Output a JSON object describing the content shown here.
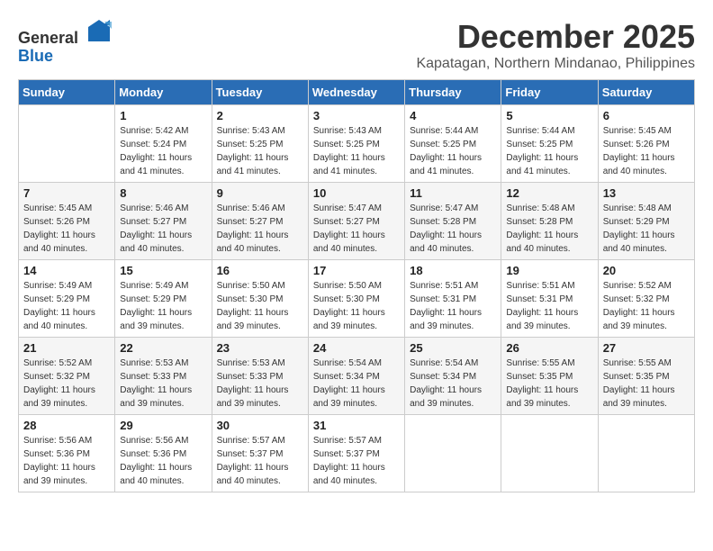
{
  "header": {
    "month_year": "December 2025",
    "location": "Kapatagan, Northern Mindanao, Philippines",
    "logo_general": "General",
    "logo_blue": "Blue"
  },
  "weekdays": [
    "Sunday",
    "Monday",
    "Tuesday",
    "Wednesday",
    "Thursday",
    "Friday",
    "Saturday"
  ],
  "weeks": [
    [
      {
        "day": "",
        "sunrise": "",
        "sunset": "",
        "daylight": ""
      },
      {
        "day": "1",
        "sunrise": "5:42 AM",
        "sunset": "5:24 PM",
        "daylight": "11 hours and 41 minutes."
      },
      {
        "day": "2",
        "sunrise": "5:43 AM",
        "sunset": "5:25 PM",
        "daylight": "11 hours and 41 minutes."
      },
      {
        "day": "3",
        "sunrise": "5:43 AM",
        "sunset": "5:25 PM",
        "daylight": "11 hours and 41 minutes."
      },
      {
        "day": "4",
        "sunrise": "5:44 AM",
        "sunset": "5:25 PM",
        "daylight": "11 hours and 41 minutes."
      },
      {
        "day": "5",
        "sunrise": "5:44 AM",
        "sunset": "5:25 PM",
        "daylight": "11 hours and 41 minutes."
      },
      {
        "day": "6",
        "sunrise": "5:45 AM",
        "sunset": "5:26 PM",
        "daylight": "11 hours and 40 minutes."
      }
    ],
    [
      {
        "day": "7",
        "sunrise": "5:45 AM",
        "sunset": "5:26 PM",
        "daylight": "11 hours and 40 minutes."
      },
      {
        "day": "8",
        "sunrise": "5:46 AM",
        "sunset": "5:27 PM",
        "daylight": "11 hours and 40 minutes."
      },
      {
        "day": "9",
        "sunrise": "5:46 AM",
        "sunset": "5:27 PM",
        "daylight": "11 hours and 40 minutes."
      },
      {
        "day": "10",
        "sunrise": "5:47 AM",
        "sunset": "5:27 PM",
        "daylight": "11 hours and 40 minutes."
      },
      {
        "day": "11",
        "sunrise": "5:47 AM",
        "sunset": "5:28 PM",
        "daylight": "11 hours and 40 minutes."
      },
      {
        "day": "12",
        "sunrise": "5:48 AM",
        "sunset": "5:28 PM",
        "daylight": "11 hours and 40 minutes."
      },
      {
        "day": "13",
        "sunrise": "5:48 AM",
        "sunset": "5:29 PM",
        "daylight": "11 hours and 40 minutes."
      }
    ],
    [
      {
        "day": "14",
        "sunrise": "5:49 AM",
        "sunset": "5:29 PM",
        "daylight": "11 hours and 40 minutes."
      },
      {
        "day": "15",
        "sunrise": "5:49 AM",
        "sunset": "5:29 PM",
        "daylight": "11 hours and 39 minutes."
      },
      {
        "day": "16",
        "sunrise": "5:50 AM",
        "sunset": "5:30 PM",
        "daylight": "11 hours and 39 minutes."
      },
      {
        "day": "17",
        "sunrise": "5:50 AM",
        "sunset": "5:30 PM",
        "daylight": "11 hours and 39 minutes."
      },
      {
        "day": "18",
        "sunrise": "5:51 AM",
        "sunset": "5:31 PM",
        "daylight": "11 hours and 39 minutes."
      },
      {
        "day": "19",
        "sunrise": "5:51 AM",
        "sunset": "5:31 PM",
        "daylight": "11 hours and 39 minutes."
      },
      {
        "day": "20",
        "sunrise": "5:52 AM",
        "sunset": "5:32 PM",
        "daylight": "11 hours and 39 minutes."
      }
    ],
    [
      {
        "day": "21",
        "sunrise": "5:52 AM",
        "sunset": "5:32 PM",
        "daylight": "11 hours and 39 minutes."
      },
      {
        "day": "22",
        "sunrise": "5:53 AM",
        "sunset": "5:33 PM",
        "daylight": "11 hours and 39 minutes."
      },
      {
        "day": "23",
        "sunrise": "5:53 AM",
        "sunset": "5:33 PM",
        "daylight": "11 hours and 39 minutes."
      },
      {
        "day": "24",
        "sunrise": "5:54 AM",
        "sunset": "5:34 PM",
        "daylight": "11 hours and 39 minutes."
      },
      {
        "day": "25",
        "sunrise": "5:54 AM",
        "sunset": "5:34 PM",
        "daylight": "11 hours and 39 minutes."
      },
      {
        "day": "26",
        "sunrise": "5:55 AM",
        "sunset": "5:35 PM",
        "daylight": "11 hours and 39 minutes."
      },
      {
        "day": "27",
        "sunrise": "5:55 AM",
        "sunset": "5:35 PM",
        "daylight": "11 hours and 39 minutes."
      }
    ],
    [
      {
        "day": "28",
        "sunrise": "5:56 AM",
        "sunset": "5:36 PM",
        "daylight": "11 hours and 39 minutes."
      },
      {
        "day": "29",
        "sunrise": "5:56 AM",
        "sunset": "5:36 PM",
        "daylight": "11 hours and 40 minutes."
      },
      {
        "day": "30",
        "sunrise": "5:57 AM",
        "sunset": "5:37 PM",
        "daylight": "11 hours and 40 minutes."
      },
      {
        "day": "31",
        "sunrise": "5:57 AM",
        "sunset": "5:37 PM",
        "daylight": "11 hours and 40 minutes."
      },
      {
        "day": "",
        "sunrise": "",
        "sunset": "",
        "daylight": ""
      },
      {
        "day": "",
        "sunrise": "",
        "sunset": "",
        "daylight": ""
      },
      {
        "day": "",
        "sunrise": "",
        "sunset": "",
        "daylight": ""
      }
    ]
  ]
}
